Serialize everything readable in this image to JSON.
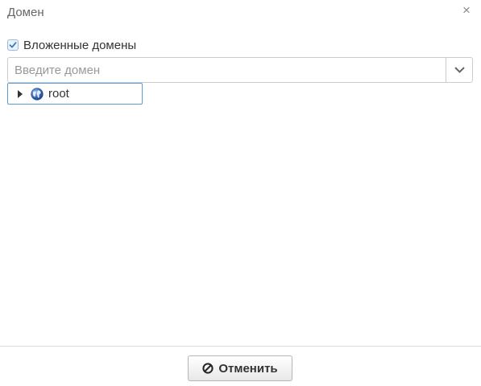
{
  "dialog": {
    "title": "Домен",
    "close_symbol": "×"
  },
  "subdomains_checkbox": {
    "label": "Вложенные домены",
    "checked": true
  },
  "domain_combo": {
    "value": "",
    "placeholder": "Введите домен",
    "toggle_icon": "chevron-down-icon"
  },
  "tree": {
    "nodes": [
      {
        "label": "root",
        "icon": "globe-icon",
        "expanded": false
      }
    ]
  },
  "footer": {
    "cancel_label": "Отменить",
    "cancel_icon": "ban-icon"
  },
  "colors": {
    "focus_border": "#5b9bd5",
    "checkbox_check": "#3a78c9"
  }
}
